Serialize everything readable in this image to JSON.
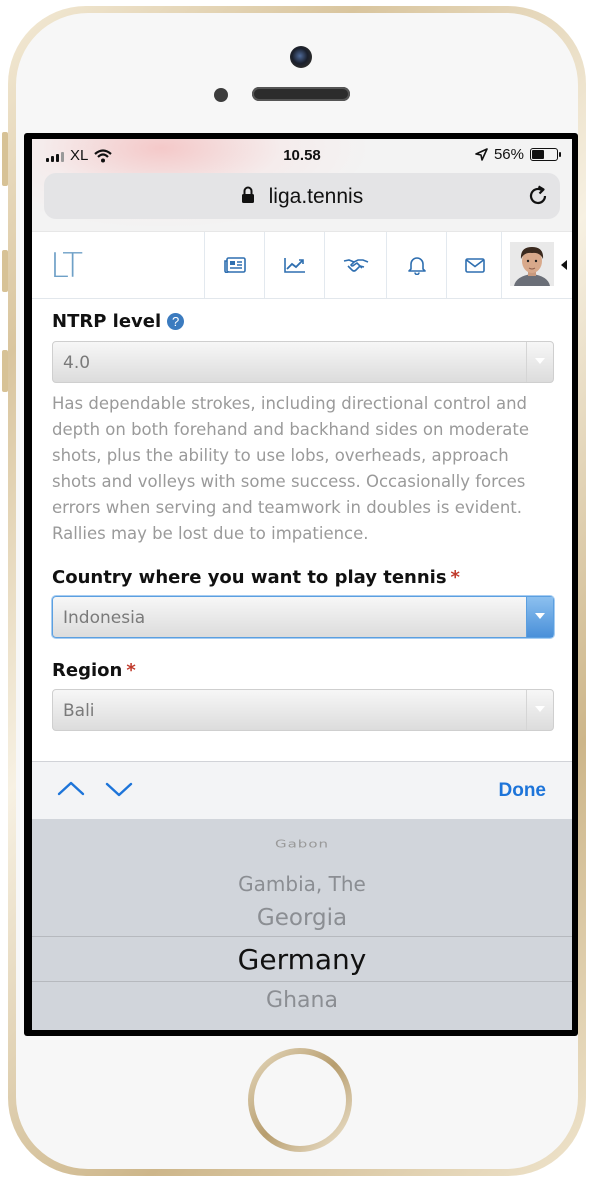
{
  "status_bar": {
    "carrier": "XL",
    "time": "10.58",
    "battery": "56%",
    "battery_level": 0.56
  },
  "browser": {
    "url": "liga.tennis"
  },
  "site": {
    "logo": "LT",
    "nav_icons": [
      "news-icon",
      "stats-icon",
      "handshake-icon",
      "bell-icon",
      "mail-icon"
    ]
  },
  "form": {
    "ntrp": {
      "label": "NTRP level",
      "help": "?",
      "value": "4.0",
      "description": "Has dependable strokes, including directional control and depth on both forehand and backhand sides on moderate shots, plus the ability to use lobs, overheads, approach shots and volleys with some success. Occasionally forces errors when serving and teamwork in doubles is evident. Rallies may be lost due to impatience."
    },
    "country": {
      "label": "Country where you want to play tennis",
      "required": "*",
      "value": "Indonesia"
    },
    "region": {
      "label": "Region",
      "required": "*",
      "value": "Bali"
    }
  },
  "keyboard": {
    "done_label": "Done"
  },
  "picker": {
    "items": [
      "Gabon",
      "Gambia, The",
      "Georgia",
      "Germany",
      "Ghana"
    ],
    "selected": "Germany"
  },
  "colors": {
    "accent": "#1d74d9",
    "logo": "#6ea0c7",
    "required": "#c0392b"
  }
}
